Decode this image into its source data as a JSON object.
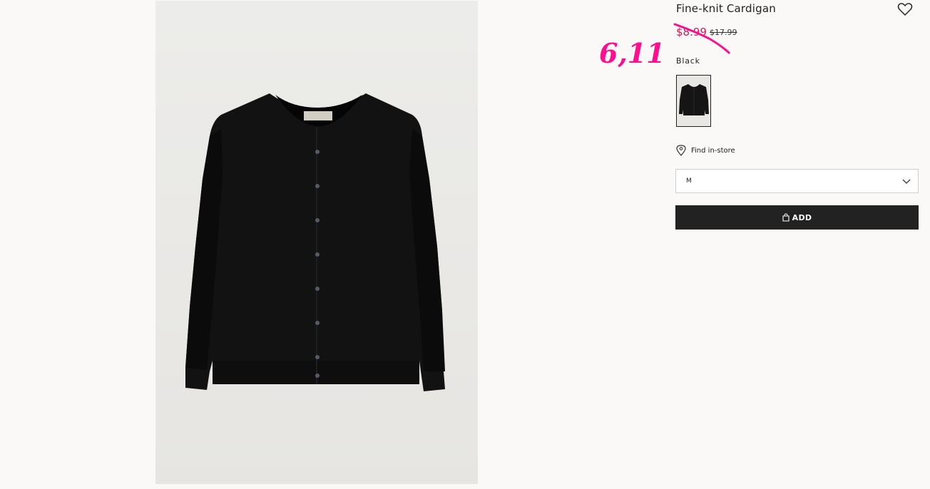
{
  "product": {
    "title": "Fine-knit Cardigan",
    "sale_price": "$8.99",
    "original_price": "$17.99",
    "color_label": "Black",
    "image_icon": "black-cardigan-image",
    "wishlist_icon": "heart-outline-icon"
  },
  "annotation": {
    "text": "6,11",
    "color": "#ff0f8f"
  },
  "store": {
    "icon": "location-pin-icon",
    "label": "Find in-store"
  },
  "size_select": {
    "selected": "M",
    "icon": "chevron-down-icon"
  },
  "cart": {
    "add_label": "ADD",
    "icon": "shopping-bag-icon"
  },
  "colors": {
    "sale": "#d6184f",
    "button_bg": "#222222",
    "page_bg": "#faf9f8"
  }
}
